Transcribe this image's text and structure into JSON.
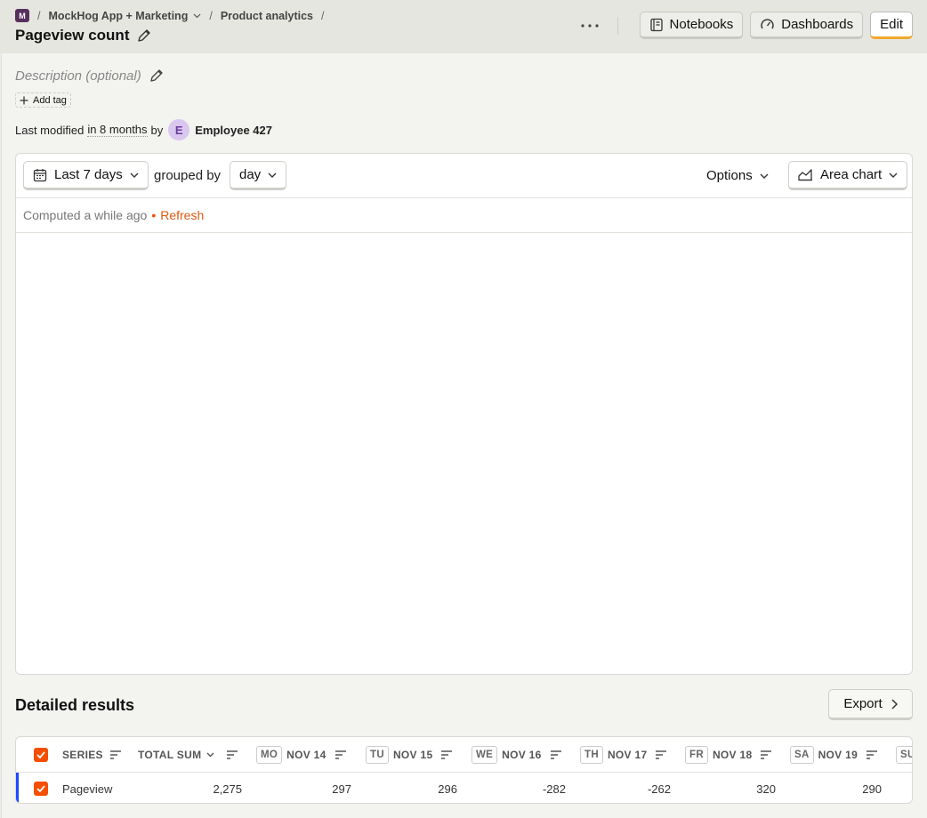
{
  "breadcrumb": {
    "project_badge": "M",
    "project": "MockHog App + Marketing",
    "section": "Product analytics",
    "separator": "/"
  },
  "page": {
    "title": "Pageview count",
    "description_placeholder": "Description (optional)",
    "add_tag": "Add tag"
  },
  "header_actions": {
    "notebooks": "Notebooks",
    "dashboards": "Dashboards",
    "edit": "Edit"
  },
  "modified": {
    "prefix": "Last modified",
    "time": "in 8 months",
    "by": "by",
    "avatar_initial": "E",
    "user": "Employee 427"
  },
  "insight": {
    "date_range": "Last 7 days",
    "grouped_by_label": "grouped by",
    "interval": "day",
    "options": "Options",
    "chart_type": "Area chart",
    "computed": "Computed a while ago",
    "bullet": "•",
    "refresh": "Refresh"
  },
  "results": {
    "title": "Detailed results",
    "export": "Export",
    "columns": {
      "series": "SERIES",
      "total": "TOTAL SUM",
      "days": [
        {
          "badge": "MO",
          "date": "NOV 14"
        },
        {
          "badge": "TU",
          "date": "NOV 15"
        },
        {
          "badge": "WE",
          "date": "NOV 16"
        },
        {
          "badge": "TH",
          "date": "NOV 17"
        },
        {
          "badge": "FR",
          "date": "NOV 18"
        },
        {
          "badge": "SA",
          "date": "NOV 19"
        },
        {
          "badge": "SU",
          "date": ""
        }
      ]
    },
    "rows": [
      {
        "series": "Pageview",
        "total": "2,275",
        "values": [
          "297",
          "296",
          "-282",
          "-262",
          "320",
          "290"
        ]
      }
    ]
  },
  "colors": {
    "accent": "#f54e00",
    "series_blue": "#1d4aff",
    "project_badge": "#55305c"
  }
}
